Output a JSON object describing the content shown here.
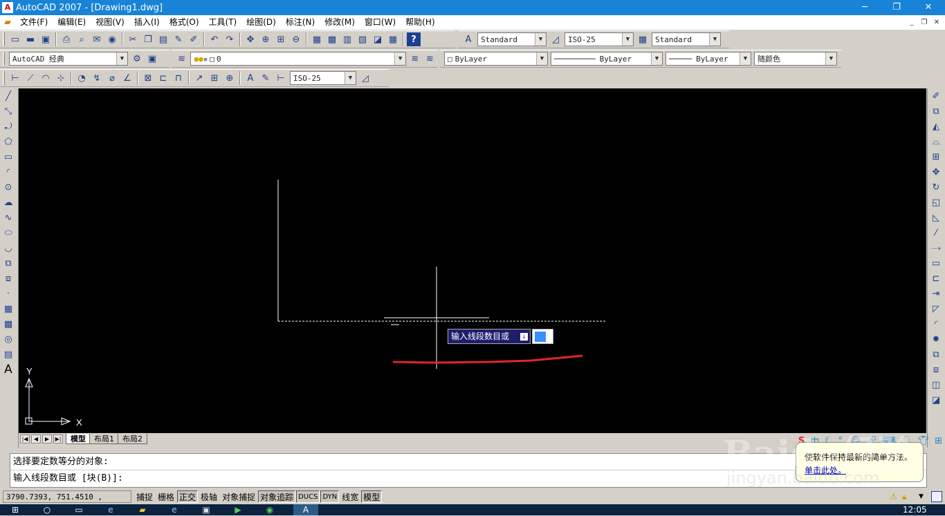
{
  "window": {
    "title": "AutoCAD 2007 - [Drawing1.dwg]",
    "app_icon": "autocad-icon",
    "controls": {
      "minimize": "─",
      "restore": "❐",
      "close": "✕"
    }
  },
  "menubar": {
    "items": [
      "文件(F)",
      "编辑(E)",
      "视图(V)",
      "插入(I)",
      "格式(O)",
      "工具(T)",
      "绘图(D)",
      "标注(N)",
      "修改(M)",
      "窗口(W)",
      "帮助(H)"
    ],
    "doc_controls": {
      "minimize": "_",
      "restore": "❐",
      "close": "✕"
    }
  },
  "toolbars": {
    "text_style": "Standard",
    "dim_style": "ISO-25",
    "table_style": "Standard",
    "workspace": "AutoCAD 经典",
    "layer": "0",
    "color": "ByLayer",
    "linetype": "ByLayer",
    "lineweight": "ByLayer",
    "plotstyle": "随颜色",
    "dim_style2": "ISO-25"
  },
  "canvas": {
    "ucs_x": "X",
    "ucs_y": "Y",
    "dyn_prompt": "输入线段数目或",
    "dyn_down": "↓",
    "background": "#000000",
    "annotation_color": "#e3252b"
  },
  "layout_tabs": [
    "模型",
    "布局1",
    "布局2"
  ],
  "command": {
    "line1": "选择要定数等分的对象:",
    "line2": "输入线段数目或 [块(B)]:"
  },
  "status": {
    "coords": "3790.7393, 751.4510 , 0.0000",
    "buttons": [
      {
        "label": "捕捉",
        "on": false
      },
      {
        "label": "栅格",
        "on": false
      },
      {
        "label": "正交",
        "on": true
      },
      {
        "label": "极轴",
        "on": false
      },
      {
        "label": "对象捕捉",
        "on": false
      },
      {
        "label": "对象追踪",
        "on": true
      },
      {
        "label": "DUCS",
        "on": true
      },
      {
        "label": "DYN",
        "on": true
      },
      {
        "label": "线宽",
        "on": false
      },
      {
        "label": "模型",
        "on": true
      }
    ]
  },
  "balloon": {
    "text": "使软件保持最新的简单方法。",
    "link": "单击此处。"
  },
  "watermark": {
    "main": "Baidu经验",
    "sub": "jingyan.baidu.com"
  },
  "taskbar": {
    "clock": "12:05"
  }
}
